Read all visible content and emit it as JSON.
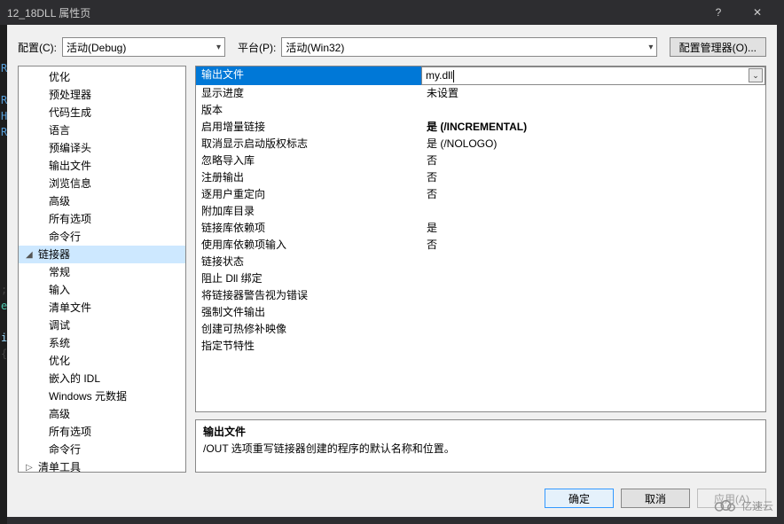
{
  "window": {
    "title": "12_18DLL 属性页",
    "help": "?",
    "close": "✕"
  },
  "config": {
    "label": "配置(C):",
    "value": "活动(Debug)",
    "platform_label": "平台(P):",
    "platform_value": "活动(Win32)",
    "manager_btn": "配置管理器(O)..."
  },
  "tree": [
    {
      "l": 1,
      "label": "优化"
    },
    {
      "l": 1,
      "label": "预处理器"
    },
    {
      "l": 1,
      "label": "代码生成"
    },
    {
      "l": 1,
      "label": "语言"
    },
    {
      "l": 1,
      "label": "预编译头"
    },
    {
      "l": 1,
      "label": "输出文件"
    },
    {
      "l": 1,
      "label": "浏览信息"
    },
    {
      "l": 1,
      "label": "高级"
    },
    {
      "l": 1,
      "label": "所有选项"
    },
    {
      "l": 1,
      "label": "命令行"
    },
    {
      "l": 0,
      "label": "链接器",
      "sel": true,
      "exp": "◢"
    },
    {
      "l": 1,
      "label": "常规"
    },
    {
      "l": 1,
      "label": "输入"
    },
    {
      "l": 1,
      "label": "清单文件"
    },
    {
      "l": 1,
      "label": "调试"
    },
    {
      "l": 1,
      "label": "系统"
    },
    {
      "l": 1,
      "label": "优化"
    },
    {
      "l": 1,
      "label": "嵌入的 IDL"
    },
    {
      "l": 1,
      "label": "Windows 元数据"
    },
    {
      "l": 1,
      "label": "高级"
    },
    {
      "l": 1,
      "label": "所有选项"
    },
    {
      "l": 1,
      "label": "命令行"
    },
    {
      "l": 0,
      "label": "清单工具",
      "exp": "▷"
    }
  ],
  "grid": [
    {
      "name": "输出文件",
      "val": "my.dll",
      "sel": true
    },
    {
      "name": "显示进度",
      "val": "未设置"
    },
    {
      "name": "版本",
      "val": ""
    },
    {
      "name": "启用增量链接",
      "val": "是 (/INCREMENTAL)",
      "bold": true
    },
    {
      "name": "取消显示启动版权标志",
      "val": "是 (/NOLOGO)"
    },
    {
      "name": "忽略导入库",
      "val": "否"
    },
    {
      "name": "注册输出",
      "val": "否"
    },
    {
      "name": "逐用户重定向",
      "val": "否"
    },
    {
      "name": "附加库目录",
      "val": ""
    },
    {
      "name": "链接库依赖项",
      "val": "是"
    },
    {
      "name": "使用库依赖项输入",
      "val": "否"
    },
    {
      "name": "链接状态",
      "val": ""
    },
    {
      "name": "阻止 Dll 绑定",
      "val": ""
    },
    {
      "name": "将链接器警告视为错误",
      "val": ""
    },
    {
      "name": "强制文件输出",
      "val": ""
    },
    {
      "name": "创建可热修补映像",
      "val": ""
    },
    {
      "name": "指定节特性",
      "val": ""
    }
  ],
  "desc": {
    "title": "输出文件",
    "text": "/OUT 选项重写链接器创建的程序的默认名称和位置。"
  },
  "actions": {
    "ok": "确定",
    "cancel": "取消",
    "apply": "应用(A)"
  },
  "watermark": "亿速云"
}
